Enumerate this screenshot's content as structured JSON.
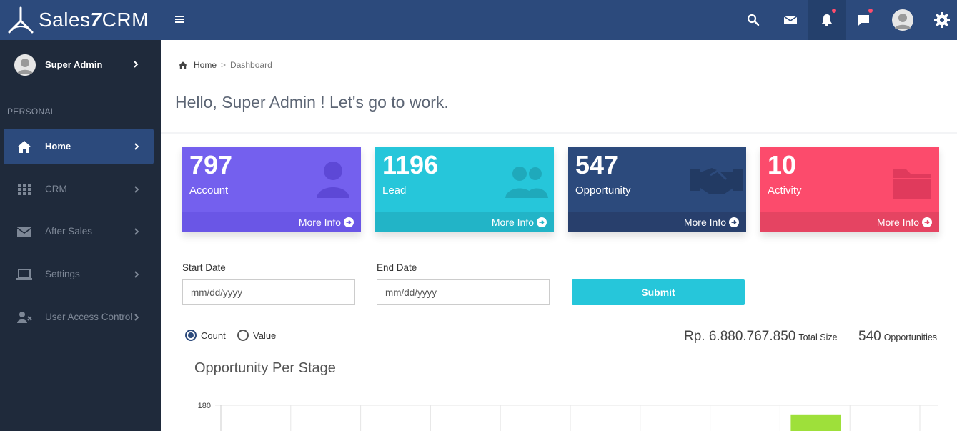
{
  "app": {
    "brand": "Sales7CRM",
    "brand_prefix": "Sales",
    "brand_suffix": "CRM",
    "brand_digit": "7"
  },
  "topbar": {
    "icons": [
      "search-icon",
      "mail-icon",
      "bell-icon",
      "chat-icon",
      "user-avatar",
      "gear-icon"
    ],
    "colors": {
      "bar": "#2c4a7c",
      "badge": "#ff4d6d"
    }
  },
  "sidebar": {
    "user_name": "Super Admin",
    "section_label": "PERSONAL",
    "items": [
      {
        "label": "Home",
        "icon": "home-icon",
        "active": true
      },
      {
        "label": "CRM",
        "icon": "grid-icon",
        "active": false
      },
      {
        "label": "After Sales",
        "icon": "mail-icon",
        "active": false
      },
      {
        "label": "Settings",
        "icon": "laptop-icon",
        "active": false
      },
      {
        "label": "User Access Control",
        "icon": "user-remove-icon",
        "active": false
      }
    ]
  },
  "breadcrumb": {
    "home": "Home",
    "separator": ">",
    "current": "Dashboard"
  },
  "greeting": "Hello, Super Admin ! Let's go to work.",
  "stats": [
    {
      "value": "797",
      "label": "Account",
      "more": "More Info",
      "icon": "user-icon",
      "color": "#7460ee",
      "footer_color": "#6a56e6"
    },
    {
      "value": "1196",
      "label": "Lead",
      "more": "More Info",
      "icon": "users-icon",
      "color": "#26c6da",
      "footer_color": "#22b4c7"
    },
    {
      "value": "547",
      "label": "Opportunity",
      "more": "More Info",
      "icon": "handshake-icon",
      "color": "#2c4a7c",
      "footer_color": "#283f6c"
    },
    {
      "value": "10",
      "label": "Activity",
      "more": "More Info",
      "icon": "folder-icon",
      "color": "#fc4b6c",
      "footer_color": "#e54462"
    }
  ],
  "filters": {
    "start_label": "Start Date",
    "start_placeholder": "mm/dd/yyyy",
    "end_label": "End Date",
    "end_placeholder": "mm/dd/yyyy",
    "submit": "Submit"
  },
  "mode": {
    "count_label": "Count",
    "value_label": "Value",
    "selected": "Count"
  },
  "summary": {
    "total_value": "Rp. 6.880.767.850",
    "total_label": "Total Size",
    "opp_value": "540",
    "opp_label": "Opportunities"
  },
  "chart_data": {
    "type": "bar",
    "title": "Opportunity Per Stage",
    "y_tick_labels": [
      "180"
    ],
    "categories": [
      "",
      "",
      "",
      "",
      "",
      "",
      "",
      "",
      "",
      ""
    ],
    "values": [
      null,
      null,
      null,
      null,
      null,
      null,
      null,
      null,
      172,
      null
    ],
    "bar_color": "#9ee03a",
    "grid": true
  }
}
